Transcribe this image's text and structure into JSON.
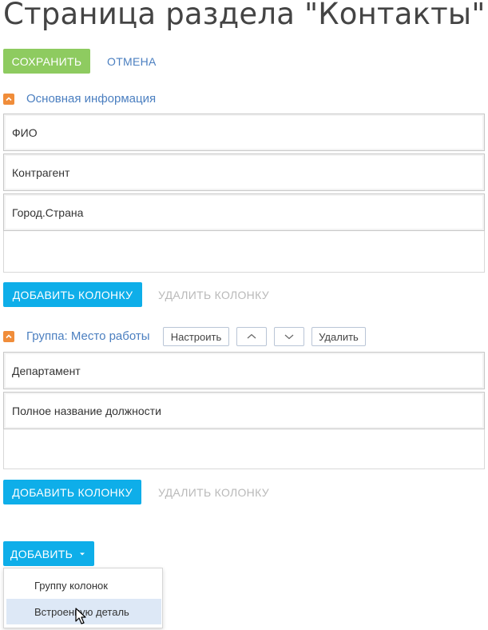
{
  "page": {
    "title": "Страница раздела \"Контакты\""
  },
  "toolbar": {
    "save_label": "СОХРАНИТЬ",
    "cancel_label": "ОТМЕНА"
  },
  "group_main": {
    "title": "Основная информация",
    "fields": [
      "ФИО",
      "Контрагент",
      "Город.Страна"
    ],
    "add_column_label": "ДОБАВИТЬ КОЛОНКУ",
    "remove_column_label": "УДАЛИТЬ КОЛОНКУ"
  },
  "group_work": {
    "title": "Группа: Место работы",
    "configure_label": "Настроить",
    "delete_label": "Удалить",
    "fields": [
      "Департамент",
      "Полное название должности"
    ],
    "add_column_label": "ДОБАВИТЬ КОЛОНКУ",
    "remove_column_label": "УДАЛИТЬ КОЛОНКУ"
  },
  "add_menu": {
    "button_label": "ДОБАВИТЬ",
    "items": [
      "Группу колонок",
      "Встроенную деталь"
    ],
    "hovered_index": 1
  },
  "colors": {
    "save_button": "#8ecb60",
    "primary_button": "#0eaee9",
    "link": "#4b7fc0",
    "collapse_icon": "#f08d3a",
    "disabled_text": "#b9b9b9",
    "menu_hover": "#dde8f6"
  },
  "icons": {
    "collapse": "chevron-up-icon",
    "move_up": "chevron-up-icon",
    "move_down": "chevron-down-icon",
    "dropdown_caret": "caret-down-icon",
    "cursor": "mouse-pointer-icon"
  }
}
